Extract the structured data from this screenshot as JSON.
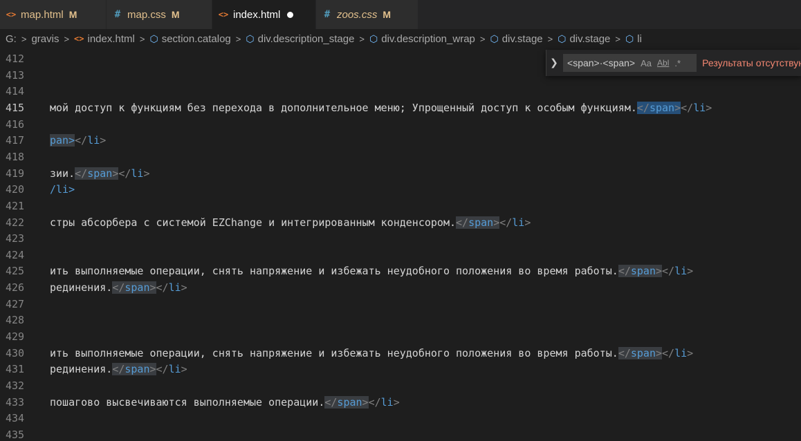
{
  "tabs": [
    {
      "icon": "html-file-icon",
      "name": "map.html",
      "status": "M",
      "active": false
    },
    {
      "icon": "css-file-icon",
      "name": "map.css",
      "status": "M",
      "active": false
    },
    {
      "icon": "html-file-icon",
      "name": "index.html",
      "status": "",
      "active": true,
      "unsaved": true
    },
    {
      "icon": "css-file-icon",
      "name": "zoos.css",
      "status": "M",
      "active": false
    }
  ],
  "breadcrumb": [
    "G:",
    "gravis",
    "index.html",
    "section.catalog",
    "div.description_stage",
    "div.description_wrap",
    "div.stage",
    "div.stage",
    "li"
  ],
  "find": {
    "query": "<span>·<span>",
    "match_case": "Aa",
    "whole_word": "Abl",
    "regex": ".*",
    "result": "Результаты отсутствуют"
  },
  "current_line": "415",
  "lines": [
    {
      "n": "412",
      "text": "",
      "close": false
    },
    {
      "n": "413",
      "text": "",
      "close": false
    },
    {
      "n": "414",
      "text": "",
      "close": false
    },
    {
      "n": "415",
      "text": "мой доступ к функциям без перехода в дополнительное меню; Упрощенный доступ к особым функциям.",
      "close": true
    },
    {
      "n": "416",
      "text": "",
      "close": false
    },
    {
      "n": "417",
      "text": "pan>",
      "close": "li"
    },
    {
      "n": "418",
      "text": "",
      "close": false
    },
    {
      "n": "419",
      "text": "зии.",
      "close": true
    },
    {
      "n": "420",
      "text": "/li>",
      "close": false
    },
    {
      "n": "421",
      "text": "",
      "close": false
    },
    {
      "n": "422",
      "text": "стры абсорбера с системой EZChange и интегрированным конденсором.",
      "close": true
    },
    {
      "n": "423",
      "text": "",
      "close": false
    },
    {
      "n": "424",
      "text": "",
      "close": false
    },
    {
      "n": "425",
      "text": "ить выполняемые операции, снять напряжение и избежать неудобного положения во время работы.",
      "close": true
    },
    {
      "n": "426",
      "text": "рединения.",
      "close": true
    },
    {
      "n": "427",
      "text": "",
      "close": false
    },
    {
      "n": "428",
      "text": "",
      "close": false
    },
    {
      "n": "429",
      "text": "",
      "close": false
    },
    {
      "n": "430",
      "text": "ить выполняемые операции, снять напряжение и избежать неудобного положения во время работы.",
      "close": true
    },
    {
      "n": "431",
      "text": "рединения.",
      "close": true
    },
    {
      "n": "432",
      "text": "",
      "close": false
    },
    {
      "n": "433",
      "text": "пошагово высвечиваются выполняемые операции.",
      "close": true
    },
    {
      "n": "434",
      "text": "",
      "close": false
    },
    {
      "n": "435",
      "text": "",
      "close": false
    }
  ],
  "syntax": {
    "close_span": "</span>",
    "close_li": "</li>"
  }
}
